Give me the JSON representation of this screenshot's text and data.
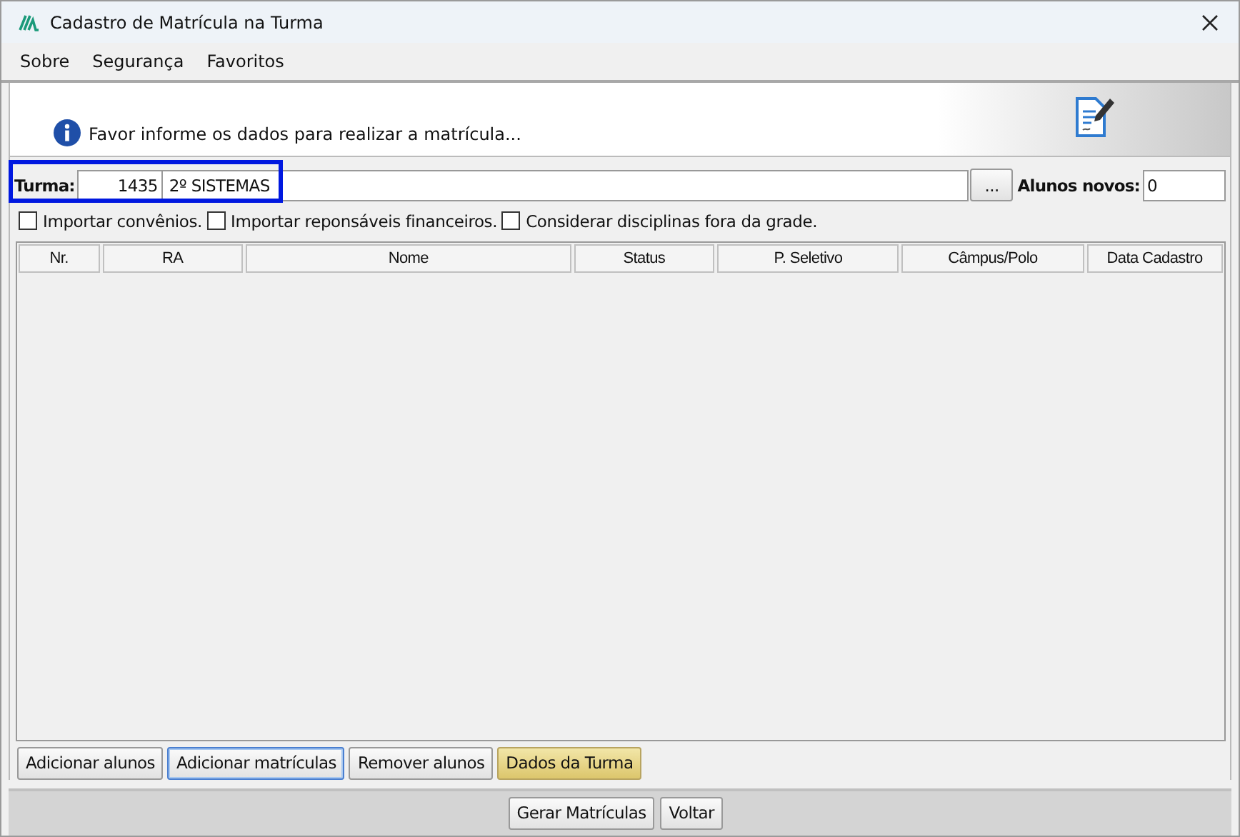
{
  "window": {
    "title": "Cadastro de Matrícula na Turma"
  },
  "menu": [
    {
      "label": "Sobre"
    },
    {
      "label": "Segurança"
    },
    {
      "label": "Favoritos"
    }
  ],
  "banner": {
    "message": "Favor informe os dados para realizar a matrícula..."
  },
  "turma": {
    "label": "Turma:",
    "code": "1435",
    "name": "2º SISTEMAS",
    "browse": "...",
    "highlighted": true
  },
  "alunos_novos": {
    "label": "Alunos novos:",
    "value": "0"
  },
  "options": [
    {
      "label": "Importar convênios.",
      "checked": false
    },
    {
      "label": "Importar reponsáveis financeiros.",
      "checked": false
    },
    {
      "label": "Considerar disciplinas fora da grade.",
      "checked": false
    }
  ],
  "table": {
    "columns": [
      "Nr.",
      "RA",
      "Nome",
      "Status",
      "P. Seletivo",
      "Câmpus/Polo",
      "Data Cadastro"
    ]
  },
  "actions": [
    {
      "label": "Adicionar alunos",
      "kind": "normal",
      "focused": false
    },
    {
      "label": "Adicionar matrículas",
      "kind": "normal",
      "focused": true
    },
    {
      "label": "Remover alunos",
      "kind": "normal",
      "focused": false
    },
    {
      "label": "Dados da Turma",
      "kind": "accent",
      "focused": false
    }
  ],
  "footer": [
    {
      "label": "Gerar Matrículas"
    },
    {
      "label": "Voltar"
    }
  ]
}
